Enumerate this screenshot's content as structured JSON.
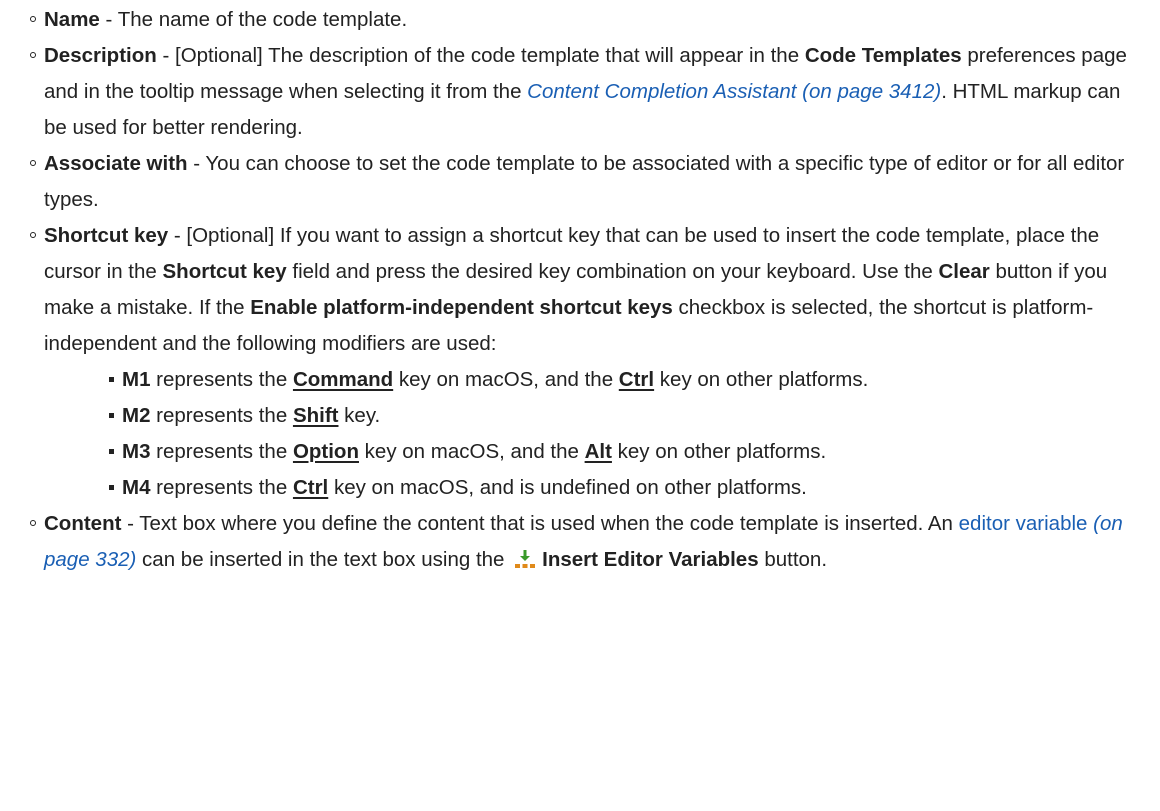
{
  "items": [
    {
      "term": "Name",
      "text": " - The name of the code template."
    },
    {
      "term": "Description",
      "t1": " - [Optional] The description of the code template that will appear in the ",
      "b1": "Code Templates",
      "t2": " preferences page and in the tooltip message when selecting it from the ",
      "link": "Content Completion Assistant (on page 3412)",
      "t3": ". HTML markup can be used for better rendering."
    },
    {
      "term": "Associate with",
      "text": " - You can choose to set the code template to be associated with a specific type of editor or for all editor types."
    },
    {
      "term": "Shortcut key",
      "t1": " - [Optional] If you want to assign a shortcut key that can be used to insert the code template, place the cursor in the ",
      "b1": "Shortcut key",
      "t2": " field and press the desired key combination on your keyboard. Use the ",
      "b2": "Clear",
      "t3": " button if you make a mistake. If the ",
      "b3": "Enable platform-independent shortcut keys",
      "t4": " checkbox is selected, the shortcut is platform-independent and the following modifiers are used:",
      "modifiers": [
        {
          "key": "M1",
          "t1": " represents the ",
          "k1": "Command",
          "t2": " key on macOS, and the ",
          "k2": "Ctrl",
          "t3": " key on other platforms."
        },
        {
          "key": "M2",
          "t1": " represents the ",
          "k1": "Shift",
          "t2": " key."
        },
        {
          "key": "M3",
          "t1": " represents the ",
          "k1": "Option",
          "t2": " key on macOS, and the ",
          "k2": "Alt",
          "t3": " key on other platforms."
        },
        {
          "key": "M4",
          "t1": " represents the ",
          "k1": "Ctrl",
          "t2": " key on macOS, and is undefined on other platforms."
        }
      ]
    },
    {
      "term": "Content",
      "t1": " - Text box where you define the content that is used when the code template is inserted. An ",
      "link_text": "editor variable",
      "link_page": " (on page 332)",
      "t2": " can be inserted in the text box using the ",
      "icon": "insert-editor-variables-icon",
      "button": "Insert Editor Variables",
      "t3": " button."
    }
  ],
  "colors": {
    "text": "#222222",
    "link": "#1a5fb4"
  }
}
